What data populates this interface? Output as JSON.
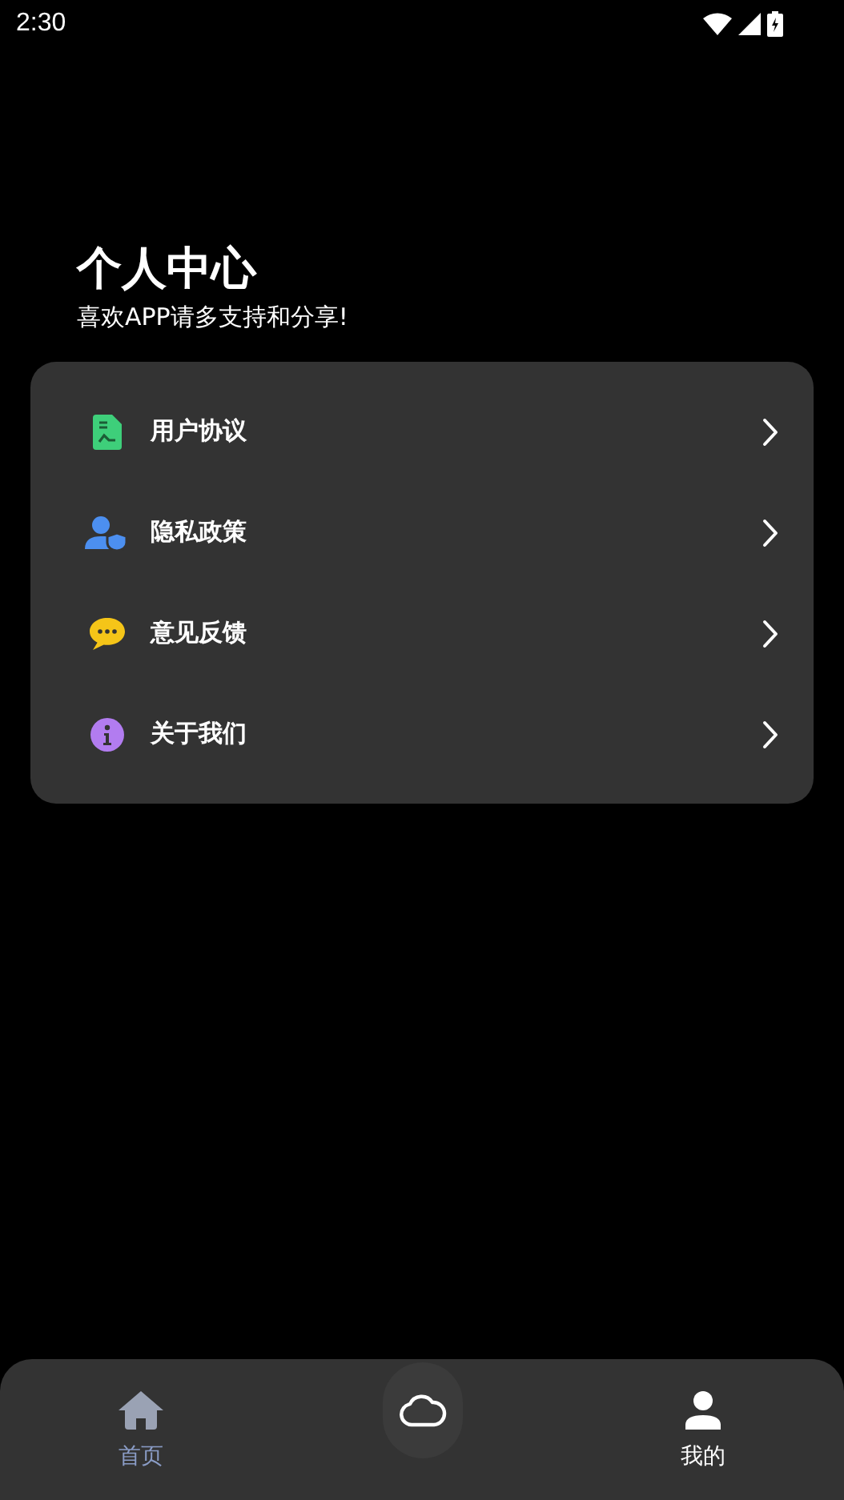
{
  "status_bar": {
    "time": "2:30"
  },
  "header": {
    "title": "个人中心",
    "subtitle": "喜欢APP请多支持和分享!"
  },
  "menu": [
    {
      "label": "用户协议"
    },
    {
      "label": "隐私政策"
    },
    {
      "label": "意见反馈"
    },
    {
      "label": "关于我们"
    }
  ],
  "bottom_nav": [
    {
      "kind": "tab",
      "label": "首页",
      "selected": false
    },
    {
      "kind": "center"
    },
    {
      "kind": "tab",
      "label": "我的",
      "selected": true
    }
  ]
}
